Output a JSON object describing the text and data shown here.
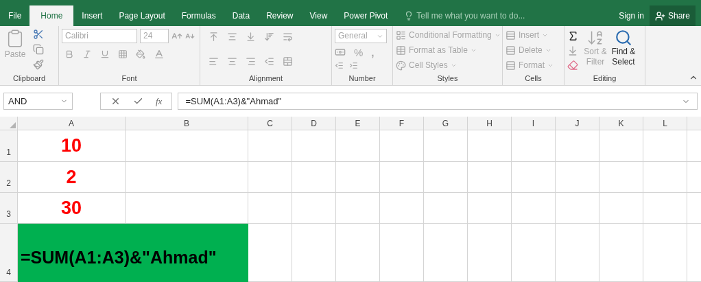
{
  "tabs": [
    {
      "label": "File",
      "selected": false
    },
    {
      "label": "Home",
      "selected": true
    },
    {
      "label": "Insert",
      "selected": false
    },
    {
      "label": "Page Layout",
      "selected": false
    },
    {
      "label": "Formulas",
      "selected": false
    },
    {
      "label": "Data",
      "selected": false
    },
    {
      "label": "Review",
      "selected": false
    },
    {
      "label": "View",
      "selected": false
    },
    {
      "label": "Power Pivot",
      "selected": false
    }
  ],
  "tell_me": {
    "placeholder": "Tell me what you want to do..."
  },
  "sign_in": "Sign in",
  "share": "Share",
  "ribbon": {
    "clipboard": {
      "label": "Clipboard",
      "paste": {
        "label": "Paste",
        "disabled": true
      }
    },
    "font": {
      "label": "Font",
      "font_name": "Calibri",
      "font_size": "24",
      "disabled": true
    },
    "alignment": {
      "label": "Alignment",
      "disabled": true
    },
    "number": {
      "label": "Number",
      "format": "General",
      "percent": "%",
      "comma": ",",
      "disabled": true
    },
    "styles": {
      "label": "Styles",
      "items": [
        {
          "label": "Conditional Formatting",
          "disabled": true
        },
        {
          "label": "Format as Table",
          "disabled": true
        },
        {
          "label": "Cell Styles",
          "disabled": true
        }
      ]
    },
    "cells": {
      "label": "Cells",
      "items": [
        {
          "label": "Insert",
          "disabled": true
        },
        {
          "label": "Delete",
          "disabled": true
        },
        {
          "label": "Format",
          "disabled": true
        }
      ]
    },
    "editing": {
      "label": "Editing",
      "sort": {
        "label": "Sort & Filter",
        "disabled": true
      },
      "find": {
        "label": "Find & Select",
        "disabled": false
      }
    }
  },
  "formula_bar": {
    "name_box": "AND",
    "function_button": "fx",
    "formula": "=SUM(A1:A3)&\"Ahmad\""
  },
  "columns": [
    "A",
    "B",
    "C",
    "D",
    "E",
    "F",
    "G",
    "H",
    "I",
    "J",
    "K",
    "L"
  ],
  "rows": [
    {
      "header": "1",
      "cells": [
        {
          "kind": "number",
          "text": "10"
        }
      ]
    },
    {
      "header": "2",
      "cells": [
        {
          "kind": "number",
          "text": "2"
        }
      ]
    },
    {
      "header": "3",
      "cells": [
        {
          "kind": "number",
          "text": "30"
        }
      ]
    },
    {
      "header": "4",
      "cells": [
        {
          "kind": "formula",
          "text": "=SUM(A1:A3)&\"Ahmad\""
        }
      ]
    }
  ]
}
